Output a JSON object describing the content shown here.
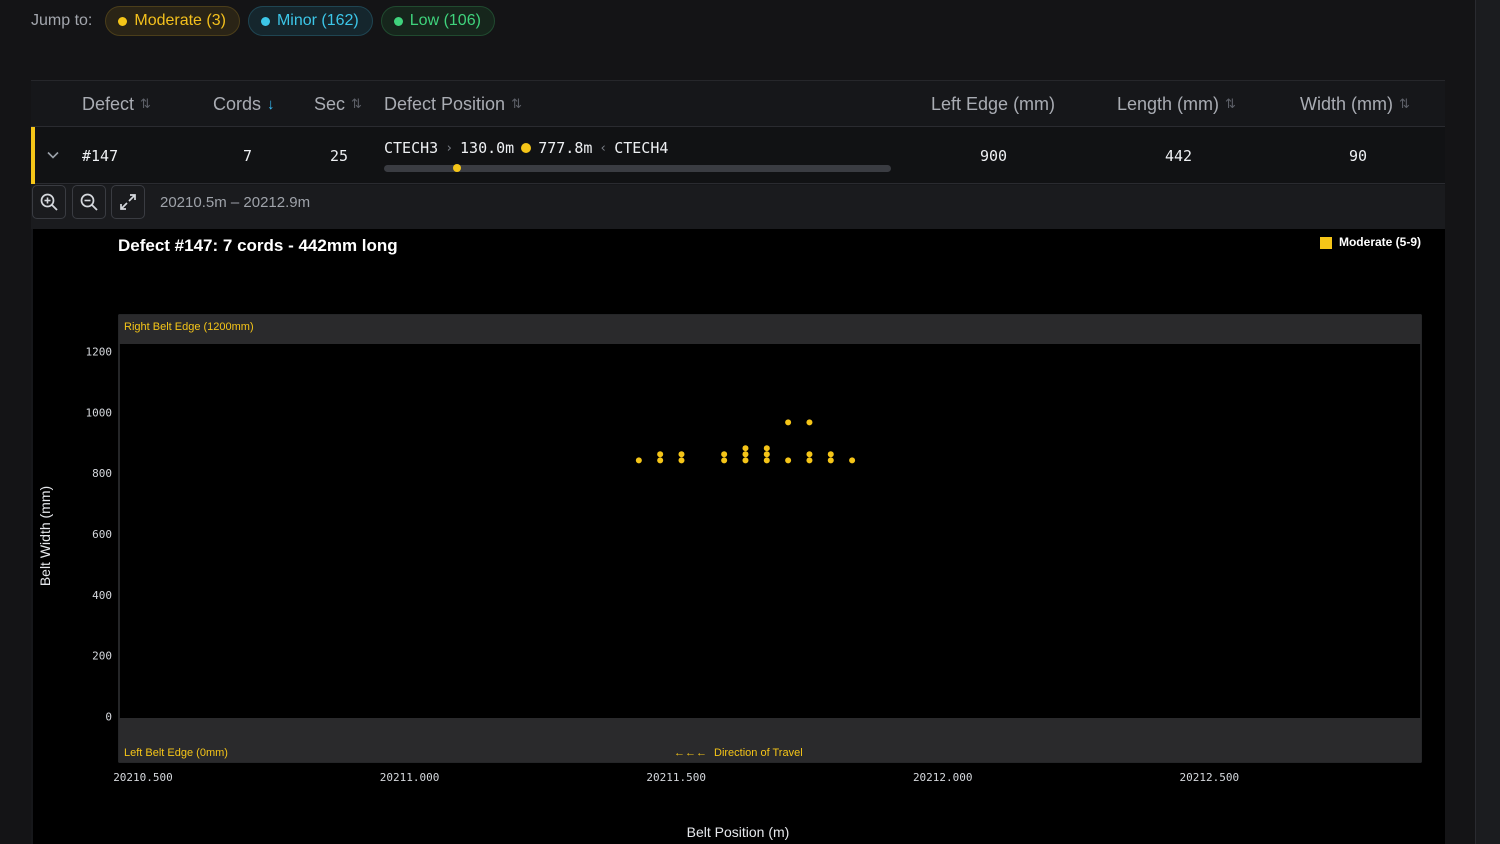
{
  "jump": {
    "label": "Jump to:",
    "pills": [
      {
        "label": "Moderate (3)",
        "severity": "moderate",
        "color": "#f5c518"
      },
      {
        "label": "Minor (162)",
        "severity": "minor",
        "color": "#3cc6e8"
      },
      {
        "label": "Low (106)",
        "severity": "low",
        "color": "#3fd37c"
      }
    ]
  },
  "table": {
    "headers": {
      "defect": "Defect",
      "cords": "Cords",
      "sec": "Sec",
      "position": "Defect Position",
      "left_edge": "Left Edge (mm)",
      "length": "Length (mm)",
      "width": "Width (mm)"
    },
    "row": {
      "defect": "#147",
      "cords": "7",
      "sec": "25",
      "pos_from": "CTECH3",
      "pos_from_dist": "130.0m",
      "pos_to_dist": "777.8m",
      "pos_to": "CTECH4",
      "pos_fraction": 0.143,
      "left_edge": "900",
      "length": "442",
      "width": "90"
    }
  },
  "toolbar": {
    "range": "20210.5m – 20212.9m"
  },
  "chart_data": {
    "type": "scatter",
    "title": "Defect #147: 7 cords - 442mm long",
    "xlabel": "Belt Position (m)",
    "ylabel": "Belt Width (mm)",
    "xlim": [
      20210.455,
      20212.897
    ],
    "ylim": [
      -150,
      1320
    ],
    "x_ticks": [
      "20210.500",
      "20211.000",
      "20211.500",
      "20212.000",
      "20212.500"
    ],
    "y_ticks": [
      "0",
      "200",
      "400",
      "600",
      "800",
      "1000",
      "1200"
    ],
    "grid": false,
    "legend": {
      "position": "top-right",
      "label": "Moderate (5-9)",
      "color": "#f5c518"
    },
    "band_top_label": "Right Belt Edge (1200mm)",
    "band_bottom_label": "Left Belt Edge (0mm)",
    "direction_label": "Direction of Travel",
    "direction_arrow": "←←←",
    "series": [
      {
        "name": "Moderate (5-9)",
        "color": "#f5c518",
        "points": [
          [
            20211.43,
            842
          ],
          [
            20211.47,
            842
          ],
          [
            20211.47,
            862
          ],
          [
            20211.51,
            842
          ],
          [
            20211.51,
            862
          ],
          [
            20211.59,
            842
          ],
          [
            20211.59,
            862
          ],
          [
            20211.63,
            842
          ],
          [
            20211.63,
            862
          ],
          [
            20211.63,
            882
          ],
          [
            20211.67,
            842
          ],
          [
            20211.67,
            862
          ],
          [
            20211.67,
            882
          ],
          [
            20211.71,
            842
          ],
          [
            20211.71,
            967
          ],
          [
            20211.75,
            842
          ],
          [
            20211.75,
            862
          ],
          [
            20211.75,
            967
          ],
          [
            20211.79,
            842
          ],
          [
            20211.79,
            862
          ],
          [
            20211.83,
            842
          ]
        ]
      }
    ]
  }
}
